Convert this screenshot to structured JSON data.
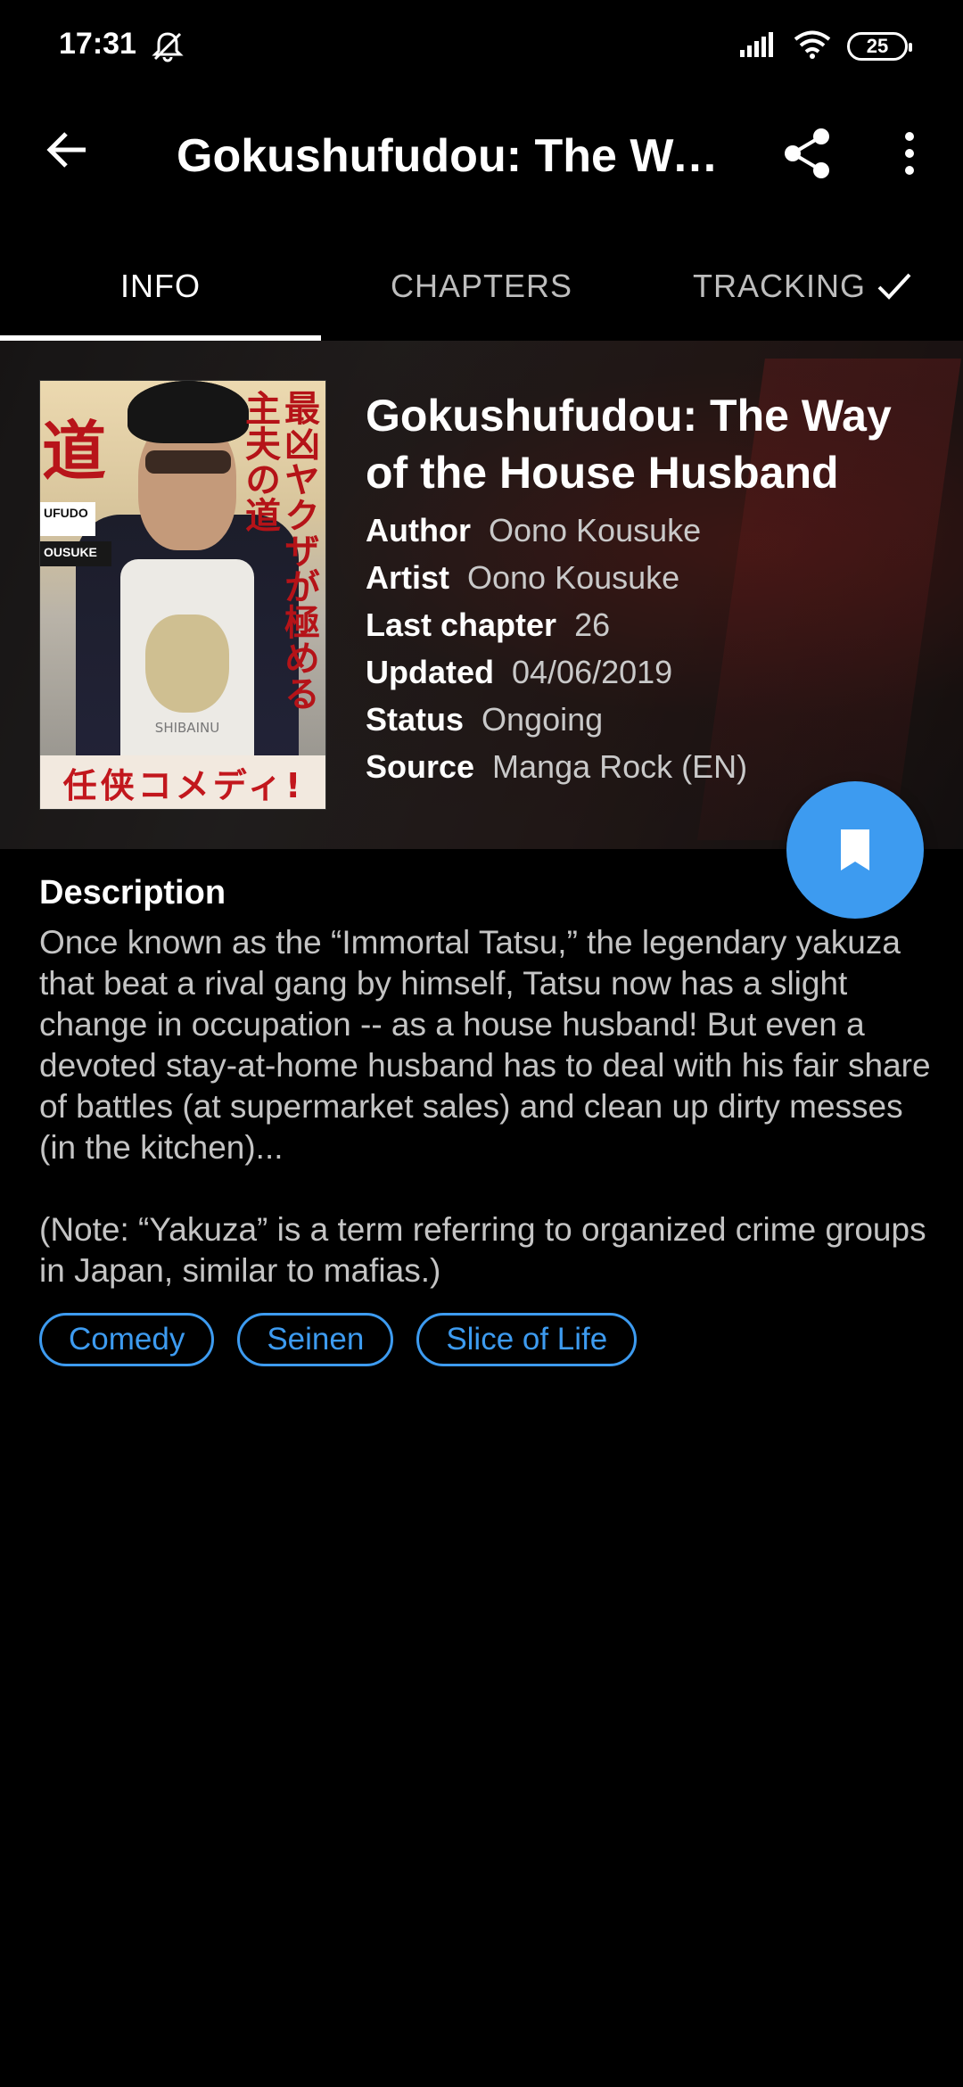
{
  "status_bar": {
    "time": "17:31",
    "battery": "25",
    "icons": [
      "bell-off-icon",
      "signal-icon",
      "wifi-icon",
      "battery-icon"
    ]
  },
  "app_bar": {
    "title": "Gokushufudou: The Way of the House Husband",
    "icons": [
      "back-arrow-icon",
      "share-icon",
      "more-vert-icon"
    ]
  },
  "tabs": [
    {
      "label": "INFO",
      "active": true
    },
    {
      "label": "CHAPTERS",
      "active": false
    },
    {
      "label": "TRACKING",
      "active": false,
      "icon": "check-icon"
    }
  ],
  "manga": {
    "title": "Gokushufudou: The Way of the House Husband",
    "rows": [
      {
        "label": "Author",
        "value": "Oono Kousuke"
      },
      {
        "label": "Artist",
        "value": "Oono Kousuke"
      },
      {
        "label": "Last chapter",
        "value": "26"
      },
      {
        "label": "Updated",
        "value": "04/06/2019"
      },
      {
        "label": "Status",
        "value": "Ongoing"
      },
      {
        "label": "Source",
        "value": "Manga Rock (EN)"
      }
    ],
    "cover": {
      "kanji_left": "道",
      "vertical_text": "最凶ヤクザが極める主夫の道",
      "bottom_text": "任侠コメディ!",
      "side_label_1": "UFUDO",
      "side_label_2": "OUSUKE",
      "dog_label": "SHIBAINU"
    }
  },
  "fab": {
    "icon": "bookmark-icon"
  },
  "description": {
    "heading": "Description",
    "paragraphs": [
      "Once known as the “Immortal Tatsu,” the legendary yakuza that beat a rival gang by himself, Tatsu now has a slight change in occupation -- as a house husband! But even a devoted stay-at-home husband has to deal with his fair share of battles (at supermarket sales) and clean up dirty messes (in the kitchen)...",
      "(Note: “Yakuza” is a term referring to organized crime groups in Japan, similar to mafias.)"
    ]
  },
  "genres": [
    "Comedy",
    "Seinen",
    "Slice of Life"
  ],
  "colors": {
    "accent": "#3d9bf0",
    "background": "#000000"
  }
}
